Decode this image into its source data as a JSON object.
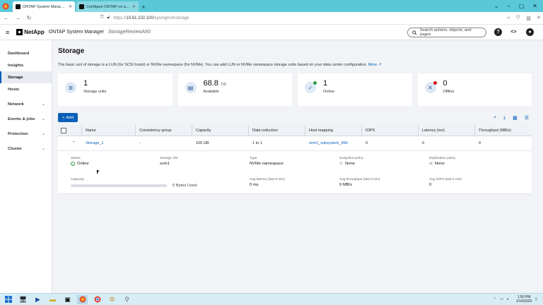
{
  "browser": {
    "tabs": [
      {
        "label": "ONTAP System Manager — Sto",
        "active": true
      },
      {
        "label": "Configure ONTAP on a new cl",
        "active": false
      }
    ],
    "url_prefix": "https://",
    "url_host": "10.61.102.100",
    "url_path": "/sysmgr/v4/storage"
  },
  "header": {
    "brand": "NetApp",
    "app_name": "ONTAP System Manager",
    "cluster_name": "StorageReviewA90",
    "search_placeholder": "Search actions, objects, and pages"
  },
  "sidebar": {
    "items": [
      {
        "label": "Dashboard",
        "active": false,
        "expandable": false
      },
      {
        "label": "Insights",
        "active": false,
        "expandable": false
      },
      {
        "label": "Storage",
        "active": true,
        "expandable": false
      },
      {
        "label": "Hosts",
        "active": false,
        "expandable": false
      },
      {
        "label": "Network",
        "active": false,
        "expandable": true
      },
      {
        "label": "Events & jobs",
        "active": false,
        "expandable": true
      },
      {
        "label": "Protection",
        "active": false,
        "expandable": true
      },
      {
        "label": "Cluster",
        "active": false,
        "expandable": true
      }
    ]
  },
  "page": {
    "title": "Storage",
    "description": "The basic unit of storage is a LUN (for SCSI hosts) or NVMe namespace (for NVMe). You can add LUN or NVMe namespace storage units based on your data center configuration.",
    "more_link": "More"
  },
  "cards": [
    {
      "value": "1",
      "unit": "",
      "label": "Storage units",
      "icon": "database-icon"
    },
    {
      "value": "68.8",
      "unit": "TiB",
      "label": "Available",
      "icon": "storage-available-icon"
    },
    {
      "value": "1",
      "unit": "",
      "label": "Online",
      "icon": "online-status-icon"
    },
    {
      "value": "0",
      "unit": "",
      "label": "Offline",
      "icon": "offline-status-icon"
    }
  ],
  "toolbar": {
    "add_label": "Add"
  },
  "table": {
    "columns": [
      "Name",
      "Consistency group",
      "Capacity",
      "Data reduction",
      "Host mapping",
      "IOPS",
      "Latency (ms)",
      "Throughput (MB/s)"
    ],
    "rows": [
      {
        "name": "Storage_1",
        "consistency_group": "-",
        "capacity": "100 GB",
        "data_reduction": "1 to 1",
        "host_mapping": "svm1_subsystem_966",
        "iops": "0",
        "latency": "0",
        "throughput": "0"
      }
    ]
  },
  "detail": {
    "status_label": "Status",
    "status_value": "Online",
    "svm_label": "Storage VM",
    "svm_value": "svm1",
    "type_label": "Type",
    "type_value": "NVMe namespace",
    "snapshot_label": "Snapshot policy",
    "snapshot_value": "None",
    "replication_label": "Replication policy",
    "replication_value": "None",
    "capacity_label": "Capacity",
    "capacity_used": "0 Bytes Used",
    "capacity_fraction": 0.0,
    "avg_latency_label": "Avg latency (last 5 min)",
    "avg_latency_value": "0 ms",
    "avg_throughput_label": "Avg throughput (last 5 min)",
    "avg_throughput_value": "0 MB/s",
    "avg_iops_label": "Avg IOPS (last 5 min)",
    "avg_iops_value": "0"
  },
  "taskbar": {
    "time": "1:50 PM",
    "date": "1/14/2025"
  },
  "colors": {
    "accent": "#0b5fb8",
    "online": "#2e9b47",
    "offline": "#d0021b"
  }
}
